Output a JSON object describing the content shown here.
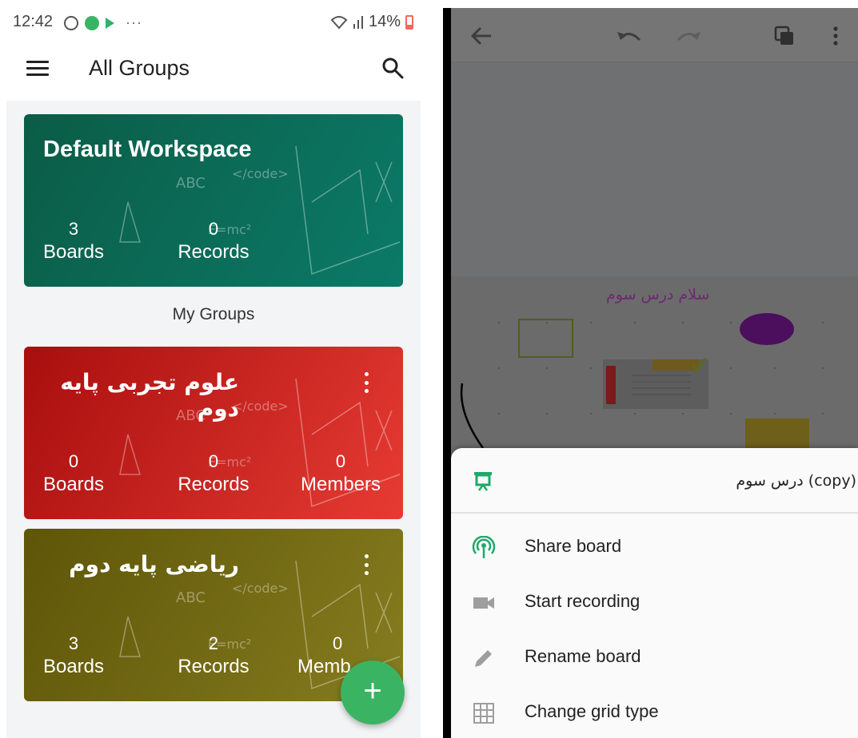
{
  "status_bar": {
    "time": "12:42",
    "more_dots": "···",
    "battery_percent": "14%"
  },
  "app_bar": {
    "title": "All Groups"
  },
  "workspace_card": {
    "title": "Default Workspace",
    "boards_count": "3",
    "boards_label": "Boards",
    "records_count": "0",
    "records_label": "Records",
    "color_from": "#0b5c46",
    "color_to": "#0b7a68"
  },
  "section_label": "My Groups",
  "groups": [
    {
      "title": "علوم تجربی پایه دوم",
      "boards_count": "0",
      "boards_label": "Boards",
      "records_count": "0",
      "records_label": "Records",
      "members_count": "0",
      "members_label": "Members",
      "color_from": "#a80e0e",
      "color_to": "#e63b33"
    },
    {
      "title": "ریاضی پایه دوم",
      "boards_count": "3",
      "boards_label": "Boards",
      "records_count": "2",
      "records_label": "Records",
      "members_count": "0",
      "members_label": "Memb",
      "color_from": "#5e5508",
      "color_to": "#867c20"
    }
  ],
  "fab": {
    "label": "+"
  },
  "board_screen": {
    "board_title": "سلام درس سوم"
  },
  "bottom_sheet": {
    "board_name": "درس سوم (copy)",
    "items": [
      {
        "label": "Share board",
        "icon": "broadcast-icon"
      },
      {
        "label": "Start recording",
        "icon": "video-camera-icon"
      },
      {
        "label": "Rename board",
        "icon": "pencil-icon"
      },
      {
        "label": "Change grid type",
        "icon": "grid-icon"
      }
    ],
    "accent_color": "#1fa86b"
  }
}
